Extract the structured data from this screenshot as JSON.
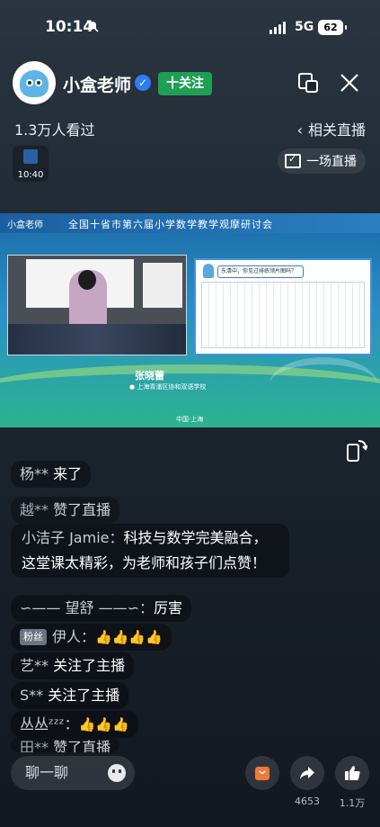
{
  "status_bar": {
    "time": "10:14",
    "network": "5G",
    "battery": "62"
  },
  "header": {
    "streamer_name": "小盒老师",
    "follow_label": "十关注",
    "viewers": "1.3万人看过",
    "related_label": "相关直播",
    "thumb_time": "10:40",
    "schedule_label": "一场直播"
  },
  "video": {
    "brand": "小盒老师",
    "title": "全国十省市第六届小学数学教学观摩研讨会",
    "teacher_name": "张晓蕾",
    "teacher_school": "● 上海青浦区协和双语学校",
    "location": "中国·上海",
    "slide_question": "东清中，你见过排练领片图吗？"
  },
  "chat": {
    "messages": [
      {
        "nick": "杨** ",
        "body": "来了"
      },
      {
        "nick": "越** ",
        "body": "赞了直播"
      },
      {
        "nick": "小洁子 Jamie：",
        "body": "科技与数学完美融合，这堂课太精彩，为老师和孩子们点赞！"
      },
      {
        "nick": "∽—— 望舒 ——∽：",
        "body": "厉害"
      },
      {
        "badge": "粉丝",
        "nick": "伊人：",
        "body": "👍👍👍👍"
      },
      {
        "nick": "艺** ",
        "body": "关注了主播"
      },
      {
        "nick": "S** ",
        "body": "关注了主播"
      },
      {
        "nick": "丛丛ᶻᶻᶻ：",
        "body": "👍👍👍"
      },
      {
        "nick": "田** ",
        "body": "赞了直播"
      }
    ]
  },
  "bottom": {
    "input_placeholder": "聊一聊",
    "share_count": "4653",
    "like_count": "1.1万"
  },
  "colors": {
    "follow": "#1f9f55",
    "verified": "#2f7cf6",
    "gift": "#f07a3a"
  }
}
